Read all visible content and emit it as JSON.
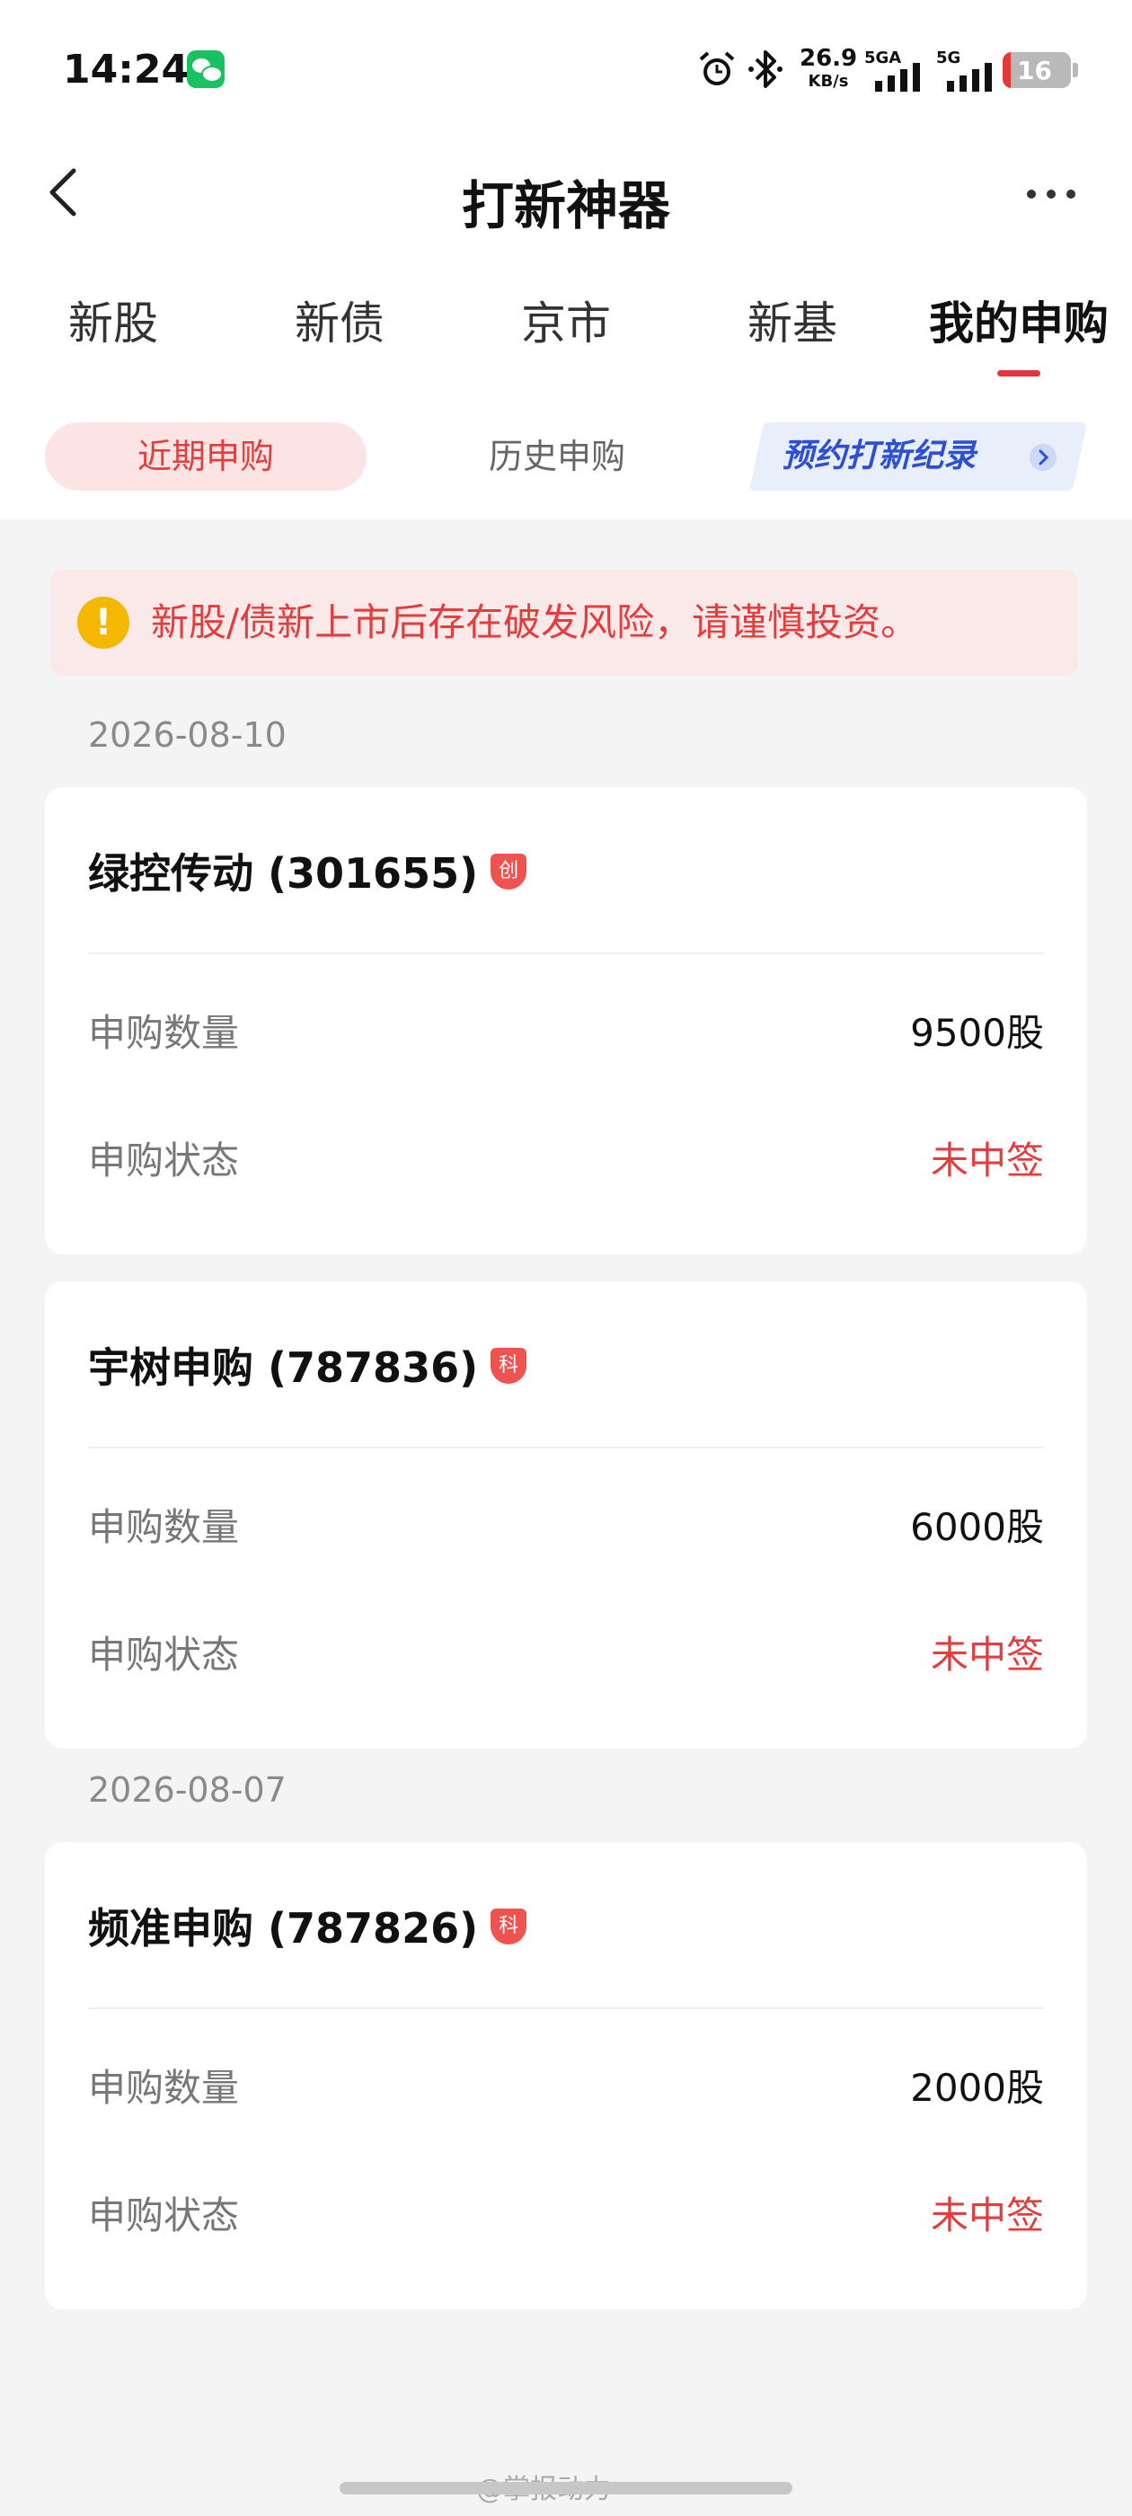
{
  "status_bar": {
    "time": "14:24",
    "net_speed_value": "26.9",
    "net_speed_unit": "KB/s",
    "signal_1_label": "5GA",
    "signal_2_label": "5G",
    "battery": "16"
  },
  "header": {
    "title": "打新神器"
  },
  "tabs": [
    "新股",
    "新债",
    "京市",
    "新基",
    "我的申购"
  ],
  "sub_tabs": {
    "recent": "近期申购",
    "history": "历史申购",
    "promo": "预约打新纪录"
  },
  "notice": "新股/债新上市后存在破发风险，请谨慎投资。",
  "groups": [
    {
      "date": "2026-08-10",
      "items": [
        {
          "name": "绿控传动 (301655)",
          "badge": "创",
          "qty_label": "申购数量",
          "qty": "9500股",
          "status_label": "申购状态",
          "status": "未中签"
        },
        {
          "name": "宇树申购 (787836)",
          "badge": "科",
          "qty_label": "申购数量",
          "qty": "6000股",
          "status_label": "申购状态",
          "status": "未中签"
        }
      ]
    },
    {
      "date": "2026-08-07",
      "items": [
        {
          "name": "频准申购 (787826)",
          "badge": "科",
          "qty_label": "申购数量",
          "qty": "2000股",
          "status_label": "申购状态",
          "status": "未中签"
        }
      ]
    }
  ],
  "watermark": "@掌报动力",
  "colors": {
    "accent": "#e53d3d",
    "promo": "#2c4fd6",
    "warning": "#f5b800"
  }
}
